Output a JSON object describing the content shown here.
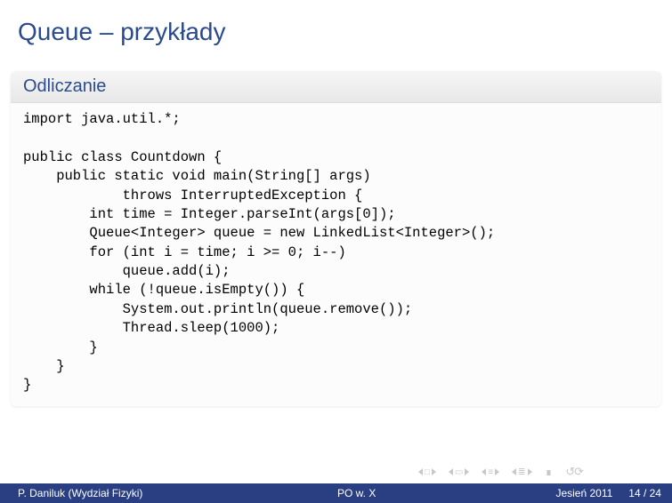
{
  "slide": {
    "title": "Queue – przykłady",
    "block_title": "Odliczanie",
    "code": "import java.util.*;\n\npublic class Countdown {\n    public static void main(String[] args)\n            throws InterruptedException {\n        int time = Integer.parseInt(args[0]);\n        Queue<Integer> queue = new LinkedList<Integer>();\n        for (int i = time; i >= 0; i--)\n            queue.add(i);\n        while (!queue.isEmpty()) {\n            System.out.println(queue.remove());\n            Thread.sleep(1000);\n        }\n    }\n}"
  },
  "footer": {
    "author": "P. Daniluk (Wydział Fizyki)",
    "short_title": "PO w. X",
    "date": "Jesień 2011",
    "page": "14 / 24"
  }
}
